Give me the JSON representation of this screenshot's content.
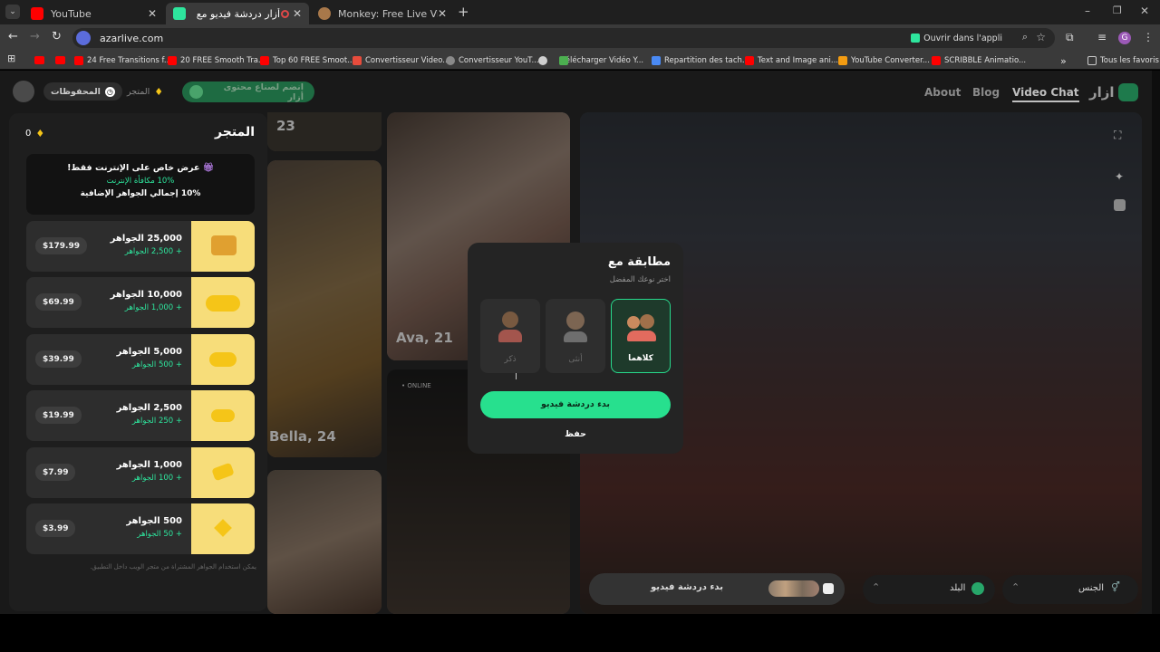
{
  "browser": {
    "tabs": [
      {
        "title": "YouTube",
        "icon": "youtube-icon"
      },
      {
        "title": "أزار دردشة فيديو مع أشخاص",
        "icon": "azar-icon"
      },
      {
        "title": "Monkey: Free Live Video Chat",
        "icon": "monkey-icon"
      }
    ],
    "url": "azarlive.com",
    "open_in_app": "Ouvrir dans l'appli",
    "bookmarks": [
      "24 Free Transitions f...",
      "20 FREE Smooth Tra...",
      "Top 60 FREE Smoot...",
      "Convertisseur Video...",
      "Convertisseur YouT...",
      "Télécharger Vidéo Y...",
      "Repartition des tach...",
      "Text and Image ani...",
      "YouTube Converter...",
      "SCRIBBLE Animatio..."
    ],
    "all_bookmarks": "Tous les favoris",
    "profile_initial": "G"
  },
  "site": {
    "logo_text": "ازار",
    "nav": [
      "Video Chat",
      "Blog",
      "About"
    ],
    "join_creators": "انضم لصناع محتوى أزار",
    "store_button": "المتجر",
    "saved_button": "المحفوظات"
  },
  "store": {
    "title": "المتجر",
    "gem_balance": "0",
    "offer": {
      "title": "عرض خاص على الإنترنت فقط!",
      "bonus_line": "10% مكافأة الإنترنت",
      "total_line": "10% إجمالي الجواهر الإضافية"
    },
    "packs": [
      {
        "gems": "25,000 الجواهر",
        "bonus": "+ 2,500 الجواهر",
        "price": "$179.99"
      },
      {
        "gems": "10,000 الجواهر",
        "bonus": "+ 1,000 الجواهر",
        "price": "$69.99"
      },
      {
        "gems": "5,000 الجواهر",
        "bonus": "+ 500 الجواهر",
        "price": "$39.99"
      },
      {
        "gems": "2,500 الجواهر",
        "bonus": "+ 250 الجواهر",
        "price": "$19.99"
      },
      {
        "gems": "1,000 الجواهر",
        "bonus": "+ 100 الجواهر",
        "price": "$7.99"
      },
      {
        "gems": "500 الجواهر",
        "bonus": "+ 50 الجواهر",
        "price": "$3.99"
      }
    ],
    "footnote": "يمكن استخدام الجواهر المشتراة من متجر الويب داخل التطبيق."
  },
  "profiles": [
    {
      "label": "23"
    },
    {
      "label": "Ava, 21"
    },
    {
      "label": "Bella, 24"
    },
    {
      "label": "• ONLINE"
    }
  ],
  "match_modal": {
    "title": "مطابقة مع",
    "subtitle": "اختر نوعك المفضل",
    "options": [
      "كلاهما",
      "أنثى",
      "ذكر"
    ],
    "selected": "كلاهما",
    "start_button": "بدء دردشة فيديو",
    "save_button": "حفظ"
  },
  "bottom_controls": {
    "start_video_chat": "بدء دردشة فيديو",
    "country": "البلد",
    "gender": "الجنس"
  },
  "colors": {
    "accent_green": "#27e08e",
    "gem_yellow": "#f7dd7a",
    "tab_bar": "#1f1f1f",
    "toolbar": "#3a3a3a"
  }
}
